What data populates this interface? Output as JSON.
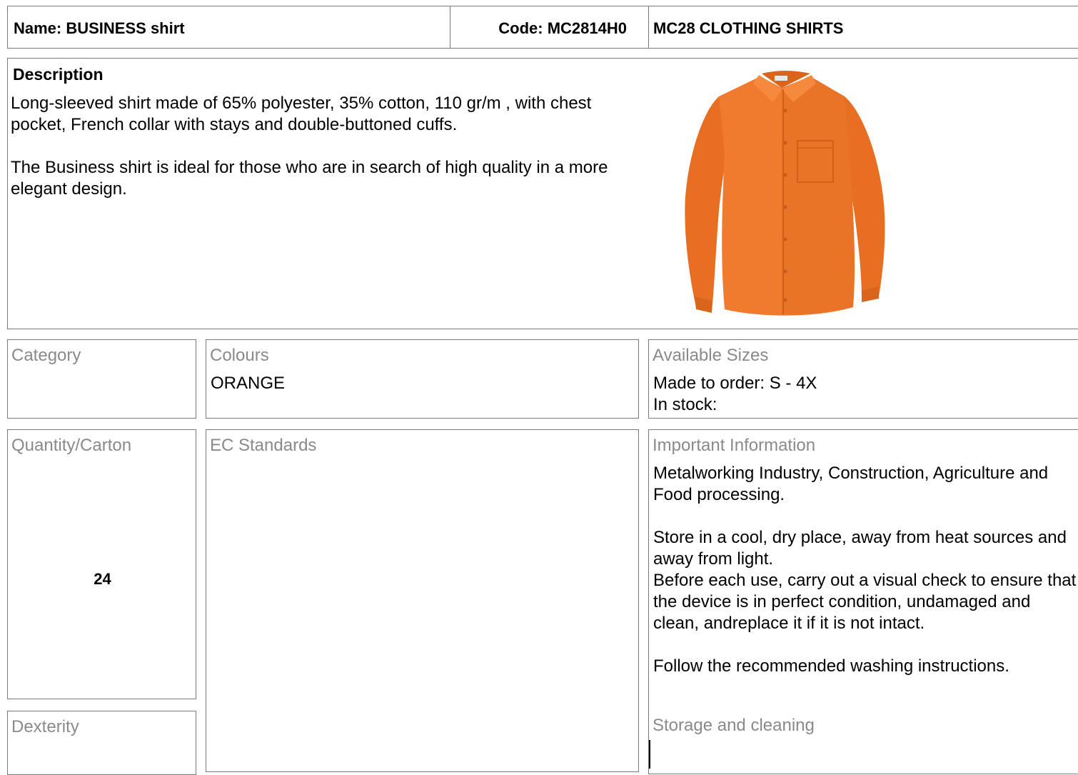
{
  "header": {
    "name": "Name: BUSINESS shirt",
    "code": "Code: MC2814H0",
    "category_line": "MC28 CLOTHING SHIRTS"
  },
  "description": {
    "title": "Description",
    "paragraphs": [
      "Long-sleeved shirt made of 65% polyester, 35% cotton, 110 gr/m , with chest pocket, French collar with stays and double-buttoned cuffs.",
      "The Business shirt is ideal for those who are in search of high quality in a more elegant design."
    ],
    "image": {
      "icon": "orange-shirt-photo",
      "color": "#f07a2e"
    }
  },
  "category": {
    "label": "Category",
    "value": ""
  },
  "colours": {
    "label": "Colours",
    "value": "ORANGE"
  },
  "sizes": {
    "label": "Available Sizes",
    "made_to_order": "Made to order: S - 4X",
    "in_stock": "In stock:"
  },
  "quantity": {
    "label": "Quantity/Carton",
    "value": "24"
  },
  "ec_standards": {
    "label": "EC Standards",
    "value": ""
  },
  "important": {
    "label": "Important Information",
    "paragraphs": [
      "Metalworking Industry, Construction, Agriculture and Food processing.",
      "Store in a cool, dry place, away from heat sources and away from light.\nBefore each use, carry out a visual check to ensure that the device is in perfect condition, undamaged and clean, andreplace it if it is not intact.",
      "Follow the recommended washing instructions."
    ]
  },
  "dexterity": {
    "label": "Dexterity",
    "value": ""
  },
  "storage": {
    "label": "Storage and cleaning",
    "value": ""
  },
  "colors": {
    "border": "#7a7a7a",
    "label_gray": "#8a8a8a",
    "shirt_orange": "#f07a2e"
  }
}
